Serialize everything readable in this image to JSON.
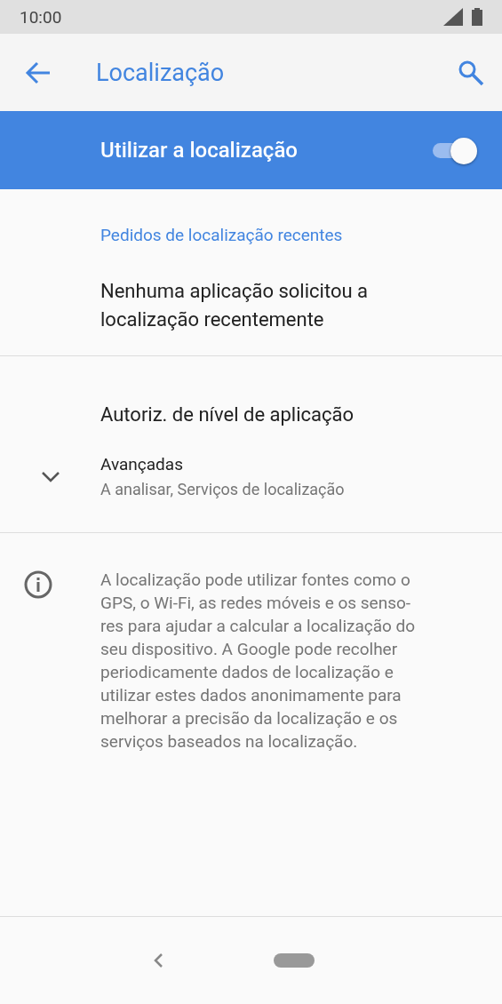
{
  "status_bar": {
    "time": "10:00"
  },
  "app_bar": {
    "title": "Localização"
  },
  "master_switch": {
    "label": "Utilizar a localização",
    "on": true
  },
  "recent_requests": {
    "header": "Pedidos de localização recentes",
    "empty_text_lines": [
      "Nenhuma aplicação solicitou a",
      "localização recentemente"
    ]
  },
  "items": [
    {
      "kind": "plain",
      "title": "Autoriz. de nível de aplicação"
    },
    {
      "kind": "expandable",
      "title": "Avançadas",
      "summary": "A analisar, Serviços de localização",
      "expanded": false
    }
  ],
  "footer_info": {
    "lines": [
      "A localização pode utilizar fontes como o",
      "GPS, o Wi-Fi, as redes móveis e os senso-",
      "res para ajudar a calcular a localização do",
      "seu dispositivo. A Google pode recolher",
      "periodicamente dados de localização e",
      "utilizar estes dados anonimamente para",
      "melhorar a precisão da localização e os",
      "serviços baseados na localização."
    ]
  }
}
